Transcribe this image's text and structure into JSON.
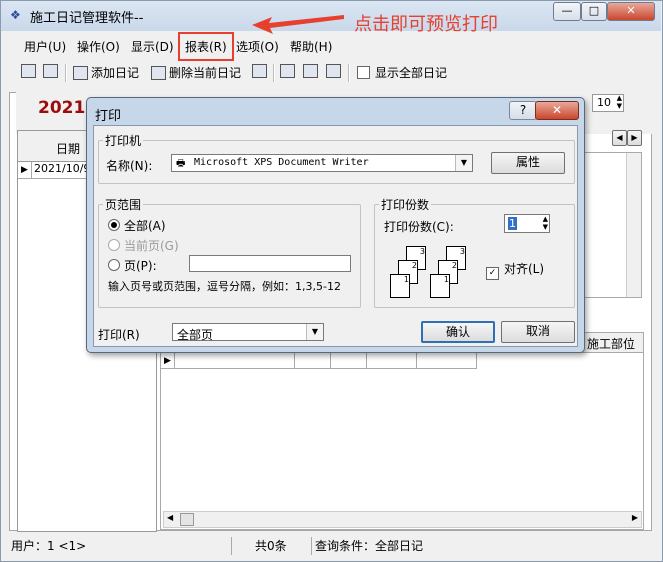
{
  "window": {
    "title": "施工日记管理软件--",
    "btn_min": "—",
    "btn_max": "□",
    "btn_close": "✕"
  },
  "annotation": {
    "hint": "点击即可预览打印"
  },
  "menubar": {
    "items": [
      "用户(U)",
      "操作(O)",
      "显示(D)",
      "报表(R)",
      "选项(O)",
      "帮助(H)"
    ]
  },
  "toolbar": {
    "add": "添加日记",
    "delete": "删除当前日记",
    "show_all": "显示全部日记"
  },
  "main": {
    "year_label": "2021",
    "spin_value": "10",
    "grid_header": "日期",
    "grid_row": "2021/10/9",
    "lower_header_right": "施工部位"
  },
  "statusbar": {
    "user": "用户：1 <1>",
    "count": "共0条",
    "query": "查询条件：全部日记"
  },
  "dialog": {
    "title": "打印",
    "help": "?",
    "close": "✕",
    "printer_group": "打印机",
    "name_label": "名称(N):",
    "printer_name": "Microsoft XPS Document Writer",
    "properties": "属性",
    "range_group": "页范围",
    "all_option": "全部(A)",
    "current_option": "当前页(G)",
    "pages_option": "页(P):",
    "pages_value": "",
    "range_hint": "输入页号或页范围，逗号分隔，例如：1,3,5-12",
    "copies_group": "打印份数",
    "copies_label": "打印份数(C):",
    "copies_value": "1",
    "collate": "对齐(L)",
    "print_label": "打印(R)",
    "print_value": "全部页",
    "ok": "确认",
    "cancel": "取消",
    "collate_checked": true
  }
}
